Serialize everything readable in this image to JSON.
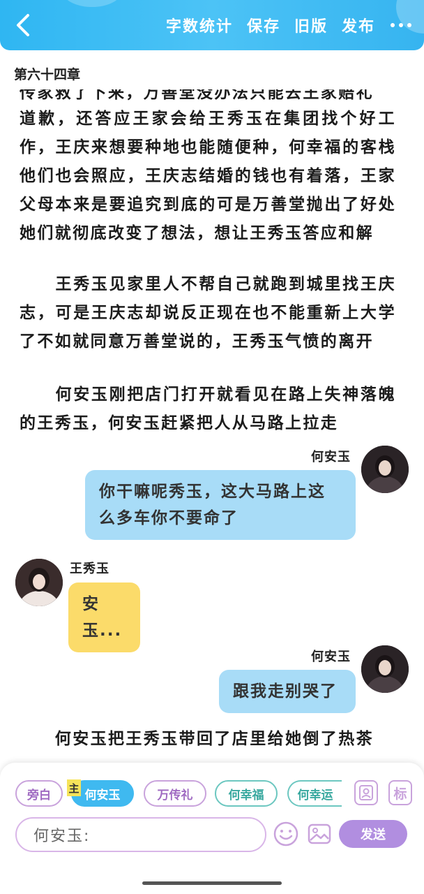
{
  "header": {
    "actions": [
      "字数统计",
      "保存",
      "旧版",
      "发布"
    ]
  },
  "chapter": {
    "title": "第六十四章"
  },
  "content": {
    "clipped_line": "传家救了下来，万善堂没办法只能去王家赔礼",
    "para1": "道歉，还答应王家会给王秀玉在集团找个好工作，王庆来想要种地也能随便种，何幸福的客栈他们也会照应，王庆志结婚的钱也有着落，王家父母本来是要追究到底的可是万善堂抛出了好处她们就彻底改变了想法，想让王秀玉答应和解",
    "para2": "　　王秀玉见家里人不帮自己就跑到城里找王庆志，可是王庆志却说反正现在也不能重新上大学了不如就同意万善堂说的，王秀玉气愤的离开",
    "para3": "　　何安玉刚把店门打开就看见在路上失神落魄的王秀玉，何安玉赶紧把人从马路上拉走",
    "para4": "　　何安玉把王秀玉带回了店里给她倒了热茶"
  },
  "messages": [
    {
      "speaker": "何安玉",
      "text": "你干嘛呢秀玉，这大马路上这么多车你不要命了"
    },
    {
      "speaker": "王秀玉",
      "text": "安玉..."
    },
    {
      "speaker": "何安玉",
      "text": "跟我走别哭了"
    }
  ],
  "composer": {
    "host_badge": "主",
    "chips": [
      "旁白",
      "何安玉",
      "万传礼",
      "何幸福",
      "何幸运"
    ],
    "icon_label": "标",
    "input_value": "何安玉:",
    "send_label": "发送"
  },
  "colors": {
    "header": "#3fb9f0",
    "bubble_blue": "#a8dcf7",
    "bubble_yellow": "#fbdb6a",
    "accent_purple": "#b18ee0"
  }
}
